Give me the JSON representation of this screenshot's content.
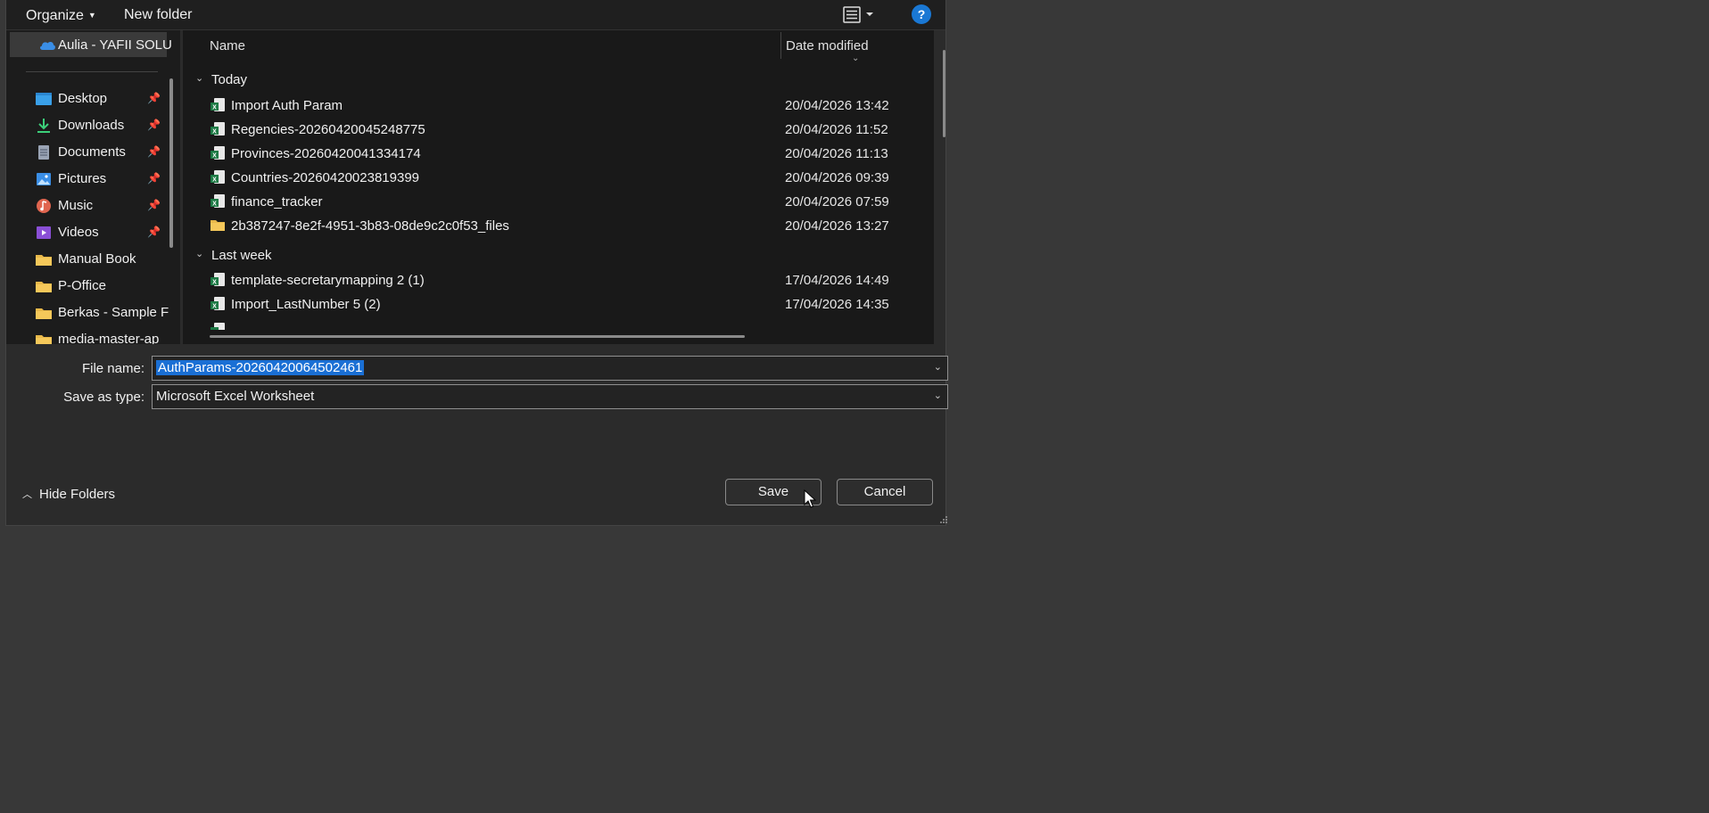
{
  "toolbar": {
    "organize_label": "Organize",
    "new_folder_label": "New folder",
    "help_glyph": "?"
  },
  "nav": {
    "cloud_label": "Aulia - YAFII SOLU",
    "items": [
      {
        "label": "Desktop",
        "icon": "desktop-icon",
        "pinned": true
      },
      {
        "label": "Downloads",
        "icon": "download-icon",
        "pinned": true
      },
      {
        "label": "Documents",
        "icon": "document-icon",
        "pinned": true
      },
      {
        "label": "Pictures",
        "icon": "picture-icon",
        "pinned": true
      },
      {
        "label": "Music",
        "icon": "music-icon",
        "pinned": true
      },
      {
        "label": "Videos",
        "icon": "video-icon",
        "pinned": true
      },
      {
        "label": "Manual Book",
        "icon": "folder-icon",
        "pinned": false
      },
      {
        "label": "P-Office",
        "icon": "folder-icon",
        "pinned": false
      },
      {
        "label": "Berkas - Sample F",
        "icon": "folder-icon",
        "pinned": false
      },
      {
        "label": "media-master-ap",
        "icon": "folder-icon",
        "pinned": false
      }
    ]
  },
  "files": {
    "col_name": "Name",
    "col_date": "Date modified",
    "groups": [
      {
        "label": "Today",
        "rows": [
          {
            "name": "Import Auth Param",
            "date": "20/04/2026 13:42",
            "icon": "excel-file-icon"
          },
          {
            "name": "Regencies-20260420045248775",
            "date": "20/04/2026 11:52",
            "icon": "excel-file-icon"
          },
          {
            "name": "Provinces-20260420041334174",
            "date": "20/04/2026 11:13",
            "icon": "excel-file-icon"
          },
          {
            "name": "Countries-20260420023819399",
            "date": "20/04/2026 09:39",
            "icon": "excel-file-icon"
          },
          {
            "name": "finance_tracker",
            "date": "20/04/2026 07:59",
            "icon": "excel-file-icon"
          },
          {
            "name": "2b387247-8e2f-4951-3b83-08de9c2c0f53_files",
            "date": "20/04/2026 13:27",
            "icon": "folder-icon"
          }
        ]
      },
      {
        "label": "Last week",
        "rows": [
          {
            "name": "template-secretarymapping 2 (1)",
            "date": "17/04/2026 14:49",
            "icon": "excel-file-icon"
          },
          {
            "name": "Import_LastNumber 5 (2)",
            "date": "17/04/2026 14:35",
            "icon": "excel-file-icon"
          }
        ]
      }
    ]
  },
  "form": {
    "file_name_label": "File name:",
    "file_name_value": "AuthParams-20260420064502461",
    "save_type_label": "Save as type:",
    "save_type_value": "Microsoft Excel Worksheet"
  },
  "footer": {
    "hide_folders_label": "Hide Folders",
    "save_label": "Save",
    "cancel_label": "Cancel"
  },
  "colors": {
    "accent": "#1a6fd4",
    "background": "#383838",
    "dialog": "#2b2b2b",
    "excel_green": "#1d7a45",
    "folder_yellow": "#e8b84a"
  }
}
